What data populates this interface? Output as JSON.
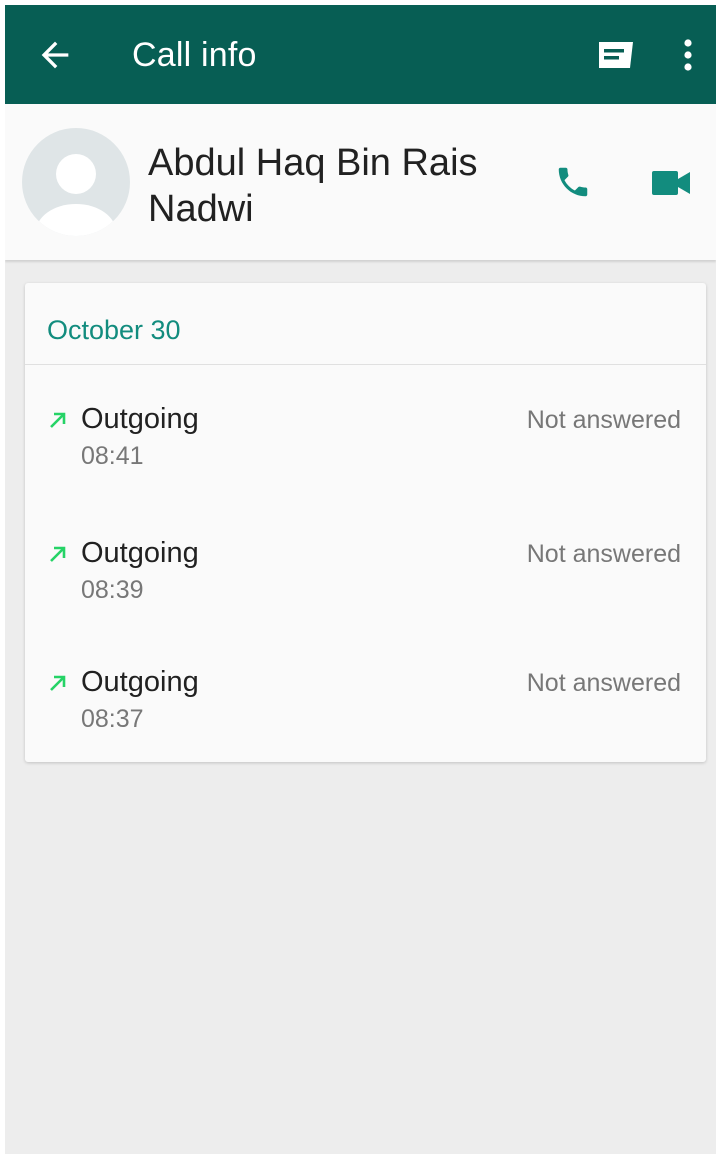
{
  "toolbar": {
    "title": "Call info",
    "back_icon": "arrow-left-icon",
    "message_icon": "message-icon",
    "more_icon": "more-vert-icon",
    "color": "#075e54"
  },
  "contact": {
    "name": "Abdul Haq Bin Rais Nadwi",
    "avatar_icon": "default-avatar-icon",
    "voice_call_icon": "phone-icon",
    "video_call_icon": "videocam-icon",
    "accent_color": "#128c7e"
  },
  "call_log": {
    "date": "October 30",
    "calls": [
      {
        "type": "Outgoing",
        "time": "08:41",
        "status": "Not answered",
        "direction_icon": "outgoing-arrow-icon"
      },
      {
        "type": "Outgoing",
        "time": "08:39",
        "status": "Not answered",
        "direction_icon": "outgoing-arrow-icon"
      },
      {
        "type": "Outgoing",
        "time": "08:37",
        "status": "Not answered",
        "direction_icon": "outgoing-arrow-icon"
      }
    ],
    "arrow_color": "#25d366"
  }
}
